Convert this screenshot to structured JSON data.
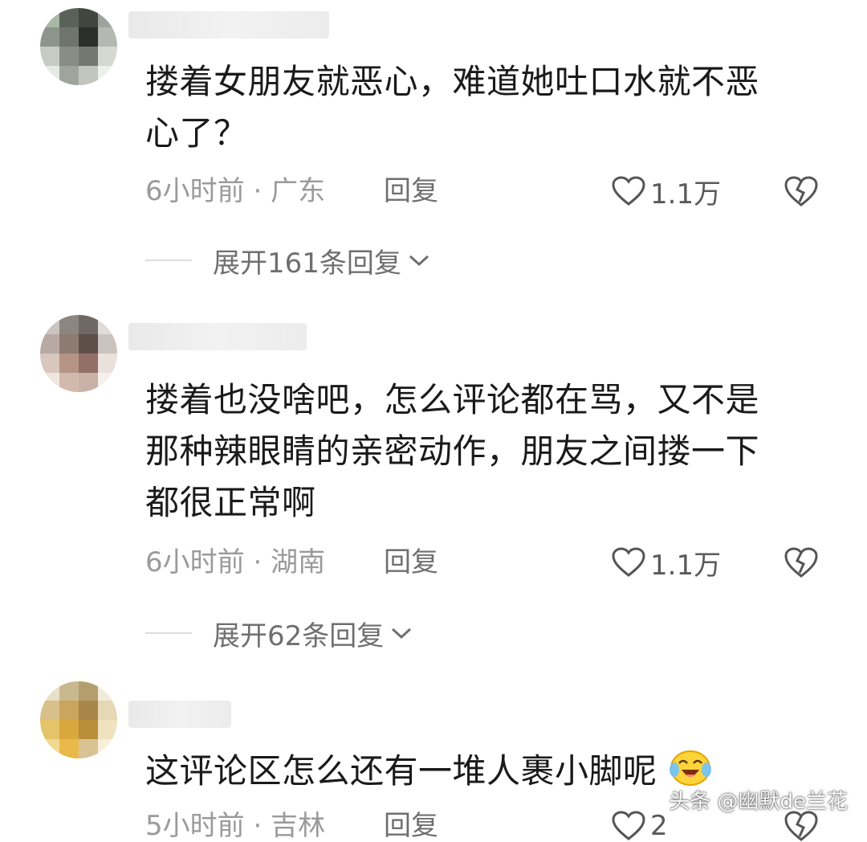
{
  "comments": [
    {
      "text_lines": [
        "搂着女朋友就恶心，难道她吐口水就不恶",
        "心了？"
      ],
      "time": "6小时前",
      "location": "广东",
      "reply_label": "回复",
      "likes": "1.1万",
      "expand_label": "展开161条回复"
    },
    {
      "text_lines": [
        "搂着也没啥吧，怎么评论都在骂，又不是",
        "那种辣眼睛的亲密动作，朋友之间搂一下",
        "都很正常啊"
      ],
      "time": "6小时前",
      "location": "湖南",
      "reply_label": "回复",
      "likes": "1.1万",
      "expand_label": "展开62条回复"
    },
    {
      "text_lines": [
        "这评论区怎么还有一堆人裹小脚呢"
      ],
      "time": "5小时前",
      "location": "吉林",
      "reply_label": "回复",
      "likes": "2"
    }
  ],
  "separator": "·",
  "watermark": "头条 @幽默de兰花",
  "icons": {
    "like": "heart-outline-icon",
    "dislike": "broken-heart-icon",
    "expand": "chevron-down-icon",
    "emoji": "laughing-crying-emoji-icon"
  },
  "colors": {
    "text": "#1a1a1a",
    "meta": "#9a9a9a",
    "action": "#6f6f6f",
    "background": "#ffffff"
  }
}
